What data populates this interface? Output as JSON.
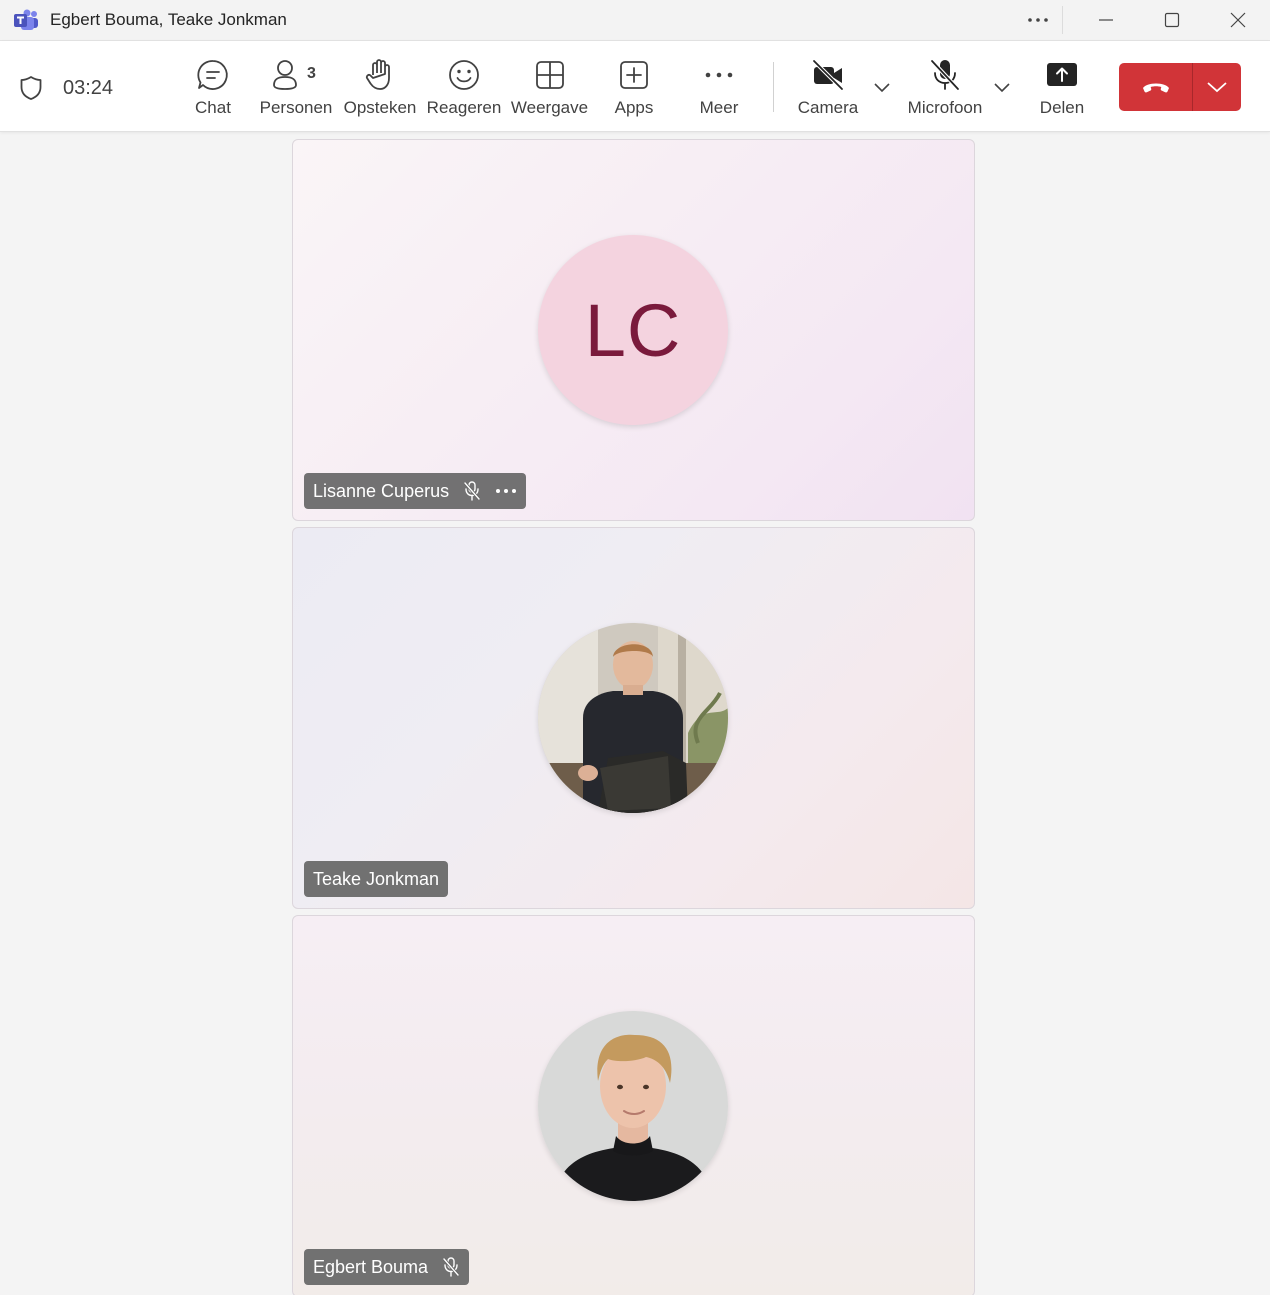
{
  "window": {
    "title": "Egbert Bouma, Teake Jonkman",
    "app_icon": "teams-logo-icon",
    "controls": [
      "more-options-icon",
      "minimize-icon",
      "maximize-icon",
      "close-icon"
    ]
  },
  "meeting": {
    "timer": "03:24"
  },
  "toolbar": {
    "chat_label": "Chat",
    "people_label": "Personen",
    "people_count": "3",
    "raise_label": "Opsteken",
    "react_label": "Reageren",
    "view_label": "Weergave",
    "apps_label": "Apps",
    "more_label": "Meer",
    "camera_label": "Camera",
    "mic_label": "Microfoon",
    "share_label": "Delen"
  },
  "colors": {
    "leave_button": "#d13438",
    "initials_bg": "#f4d3df",
    "initials_text": "#7a1a3c"
  },
  "participants": [
    {
      "name": "Lisanne Cuperus",
      "initials": "LC",
      "muted": true,
      "has_more": true
    },
    {
      "name": "Teake Jonkman",
      "initials": "",
      "muted": false,
      "has_more": false
    },
    {
      "name": "Egbert Bouma",
      "initials": "",
      "muted": true,
      "has_more": false
    }
  ]
}
